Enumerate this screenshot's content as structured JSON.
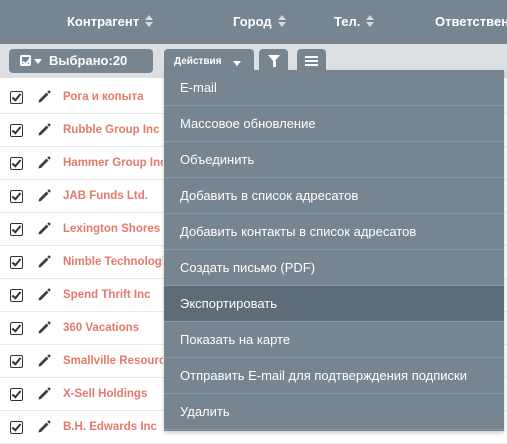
{
  "columns": {
    "contragent": "Контрагент",
    "city": "Город",
    "phone": "Тел.",
    "responsible": "Ответствен"
  },
  "toolbar": {
    "selected_label": "Выбрано:20",
    "actions_label": "Действия"
  },
  "rows": [
    {
      "name": "Рога и копыта"
    },
    {
      "name": "Rubble Group Inc"
    },
    {
      "name": "Hammer Group Inc"
    },
    {
      "name": "JAB Funds Ltd."
    },
    {
      "name": "Lexington Shores Corp"
    },
    {
      "name": "Nimble Technologies Inc"
    },
    {
      "name": "Spend Thrift Inc"
    },
    {
      "name": "360 Vacations"
    },
    {
      "name": "Smallville Resources Inc"
    },
    {
      "name": "X-Sell Holdings"
    },
    {
      "name": "B.H. Edwards Inc"
    }
  ],
  "menu": {
    "items": [
      "E-mail",
      "Массовое обновление",
      "Объединить",
      "Добавить в список адресатов",
      "Добавить контакты в список адресатов",
      "Создать письмо (PDF)",
      "Экспортировать",
      "Показать на карте",
      "Отправить E-mail для подтверждения подписки",
      "Удалить"
    ],
    "highlighted_index": 6
  },
  "colors": {
    "header_bg": "#778591",
    "toolbar_bg": "#dcdfe3",
    "link": "#e37a6c",
    "menu_bg": "#778591",
    "menu_hover": "#5e6c77"
  }
}
